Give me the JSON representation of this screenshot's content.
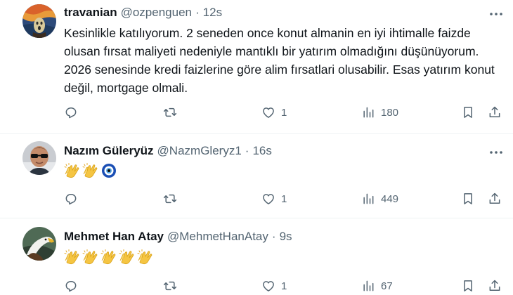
{
  "tweets": [
    {
      "name": "travanian",
      "handle": "@ozpenguen",
      "time": "12s",
      "text": "Kesinlikle katılıyorum. 2 seneden once konut almanin en iyi ihtimalle faizde olusan fırsat maliyeti nedeniyle mantıklı bir yatırım olmadığını düşünüyorum. 2026 senesinde kredi faizlerine göre alim fırsatlari olusabilir. Esas yatırım konut değil, mortgage olmali.",
      "emoji": [],
      "likes": "1",
      "views": "180",
      "avatar_icon": "scream-painting-avatar"
    },
    {
      "name": "Nazım Güleryüz",
      "handle": "@NazmGleryz1",
      "time": "16s",
      "text": "",
      "emoji": [
        "clapping-hands",
        "clapping-hands",
        "nazar-amulet"
      ],
      "likes": "1",
      "views": "449",
      "avatar_icon": "person-sunglasses-avatar"
    },
    {
      "name": "Mehmet Han Atay",
      "handle": "@MehmetHanAtay",
      "time": "9s",
      "text": "",
      "emoji": [
        "clapping-hands",
        "clapping-hands",
        "clapping-hands",
        "clapping-hands",
        "clapping-hands"
      ],
      "likes": "1",
      "views": "67",
      "avatar_icon": "eagle-avatar"
    }
  ],
  "colors": {
    "text": "#0f1419",
    "secondary": "#536471",
    "divider": "#eff3f4"
  },
  "icons": [
    "more-icon",
    "reply-icon",
    "retweet-icon",
    "like-icon",
    "views-icon",
    "bookmark-icon",
    "share-icon"
  ]
}
